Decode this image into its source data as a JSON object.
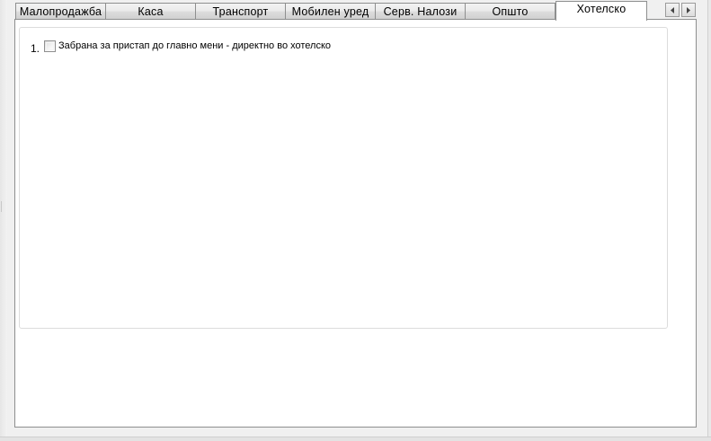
{
  "tabs": [
    {
      "label": "Малопродажба"
    },
    {
      "label": "Каса"
    },
    {
      "label": "Транспорт"
    },
    {
      "label": "Мобилен уред"
    },
    {
      "label": "Серв. Налози"
    },
    {
      "label": "Општо"
    },
    {
      "label": "Хотелско",
      "active": true
    }
  ],
  "tab_scroll": {
    "left_icon": "chevron-left-icon",
    "right_icon": "chevron-right-icon"
  },
  "panel": {
    "options": [
      {
        "number": "1.",
        "label": "Забрана за пристап до главно мени - директно во хотелско",
        "checked": false
      }
    ]
  }
}
